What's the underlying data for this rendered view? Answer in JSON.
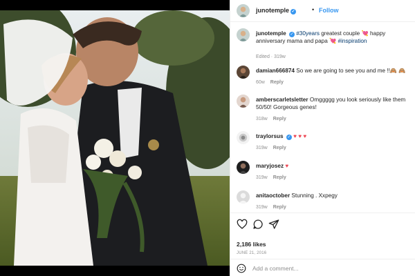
{
  "header": {
    "username": "junotemple",
    "separator": "•",
    "follow_label": "Follow"
  },
  "caption": {
    "username": "junotemple",
    "tags": "#30years",
    "text": "greatest couple",
    "text2": "happy anniversary mama and papa",
    "tag2": "#inspiration",
    "edited": "Edited · 319w"
  },
  "comments": [
    {
      "username": "damian666874",
      "text": "So we are going to see you and me !!🙈 🙈",
      "age": "60w",
      "reply": "Reply"
    },
    {
      "username": "amberscarletsletter",
      "text": "Omggggg you look seriously like them 50/50! Gorgeous genes!",
      "age": "318w",
      "reply": "Reply"
    },
    {
      "username": "traylorsus",
      "text": "♥ ♥ ♥",
      "age": "319w",
      "reply": "Reply"
    },
    {
      "username": "maryjosez",
      "text": "♥",
      "age": "319w",
      "reply": "Reply"
    },
    {
      "username": "anitaoctober",
      "text": "Stunning . Xxpegy",
      "age": "319w",
      "reply": "Reply"
    }
  ],
  "likes": "2,186 likes",
  "date": "JUNE 21, 2016",
  "add_comment_placeholder": "Add a comment...",
  "colors": {
    "accent": "#3897f0",
    "heart": "#ed4956",
    "muted": "#8e8e8e"
  },
  "icons": [
    "heart-icon",
    "comment-icon",
    "share-icon",
    "emoji-icon",
    "verified-icon"
  ]
}
